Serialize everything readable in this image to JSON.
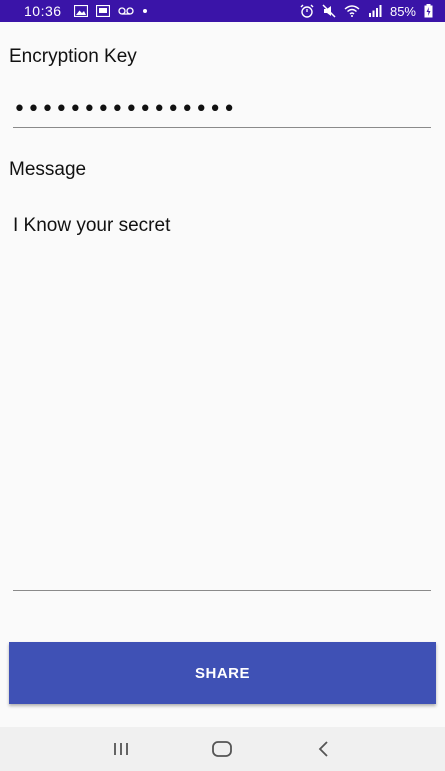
{
  "status_bar": {
    "time": "10:36",
    "battery_text": "85%",
    "left_icons": [
      "image-icon",
      "screen-icon",
      "voicemail-icon",
      "dot-icon"
    ],
    "right_icons": [
      "alarm-icon",
      "mute-icon",
      "wifi-icon",
      "signal-icon",
      "battery-charging-icon"
    ]
  },
  "form": {
    "encryption_key_label": "Encryption Key",
    "encryption_key_value": "••••••••••••••••",
    "message_label": "Message",
    "message_value": "I Know your secret"
  },
  "actions": {
    "share_label": "SHARE"
  },
  "nav_bar": {
    "buttons": [
      "recents-icon",
      "home-icon",
      "back-icon"
    ]
  },
  "colors": {
    "status_bar": "#3a14a8",
    "button": "#3f51b5",
    "background": "#fafafa"
  }
}
